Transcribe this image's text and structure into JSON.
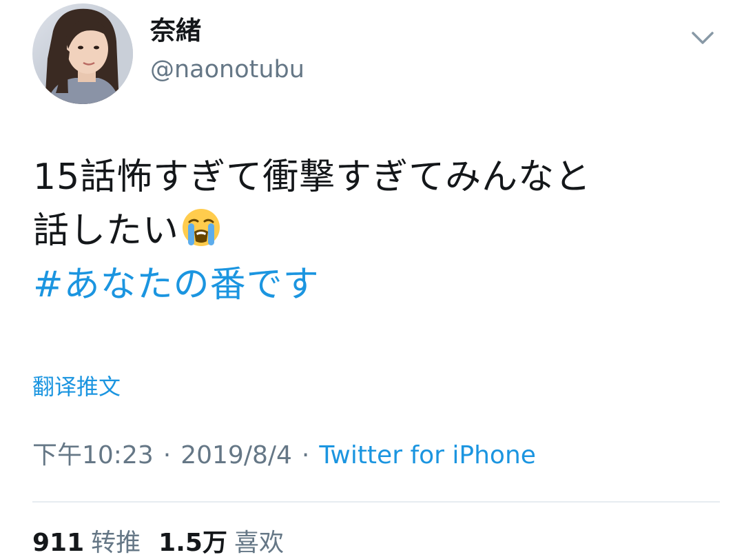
{
  "user": {
    "display_name": "奈緒",
    "handle": "@naonotubu",
    "avatar_icon": "profile-photo"
  },
  "menu": {
    "icon": "chevron-down-icon"
  },
  "tweet": {
    "line1": "15話怖すぎて衝撃すぎてみんなと",
    "line2": "話したい",
    "emoji": "loudly-crying-face-emoji",
    "hashtag": "#あなたの番です"
  },
  "translate_label": "翻译推文",
  "meta": {
    "time": "下午10:23",
    "separator": "·",
    "date": "2019/8/4",
    "source": "Twitter for iPhone"
  },
  "stats": {
    "retweets_count": "911",
    "retweets_label": "转推",
    "likes_count": "1.5万",
    "likes_label": "喜欢"
  },
  "colors": {
    "link": "#1b95e0",
    "secondary": "#657786",
    "text": "#14171a",
    "divider": "#e6ecf0"
  }
}
